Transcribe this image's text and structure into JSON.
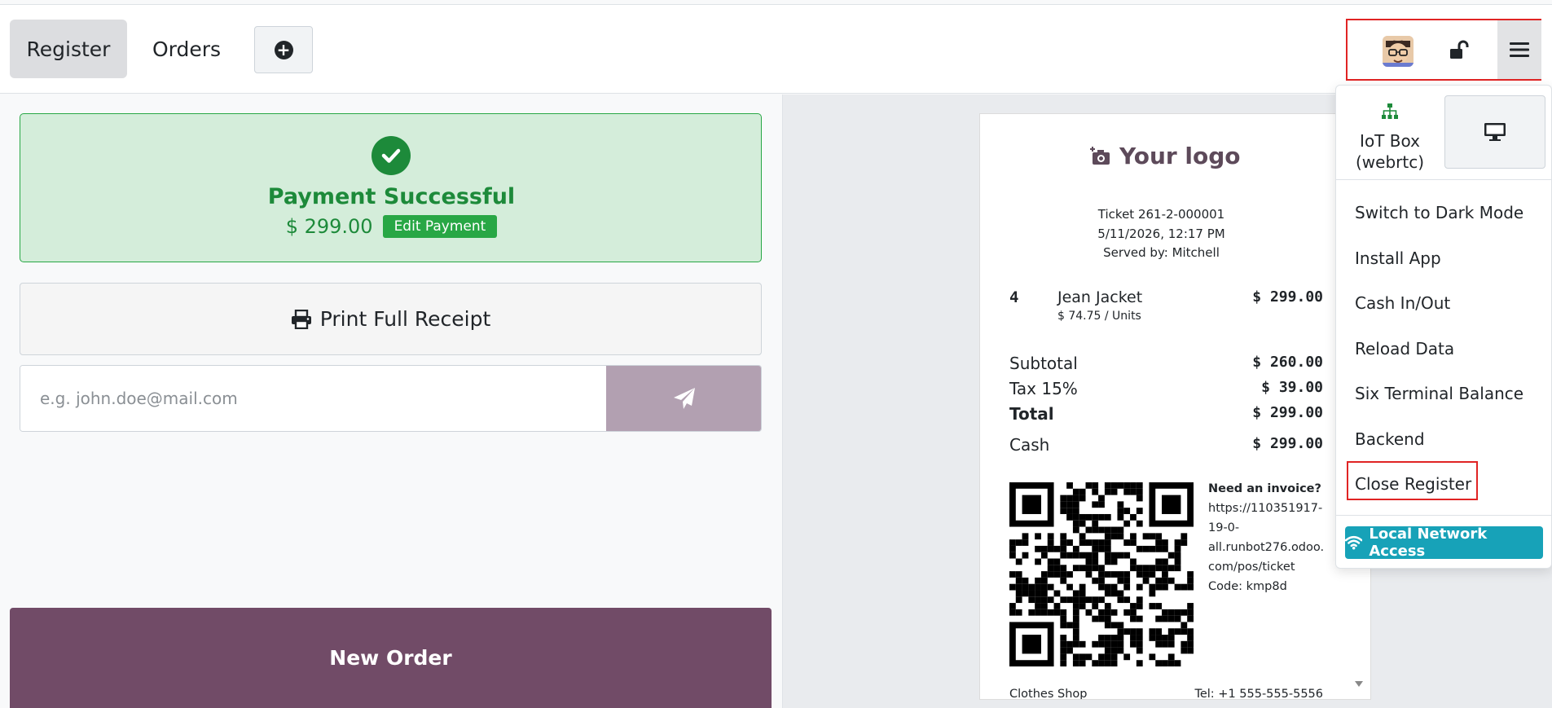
{
  "header": {
    "tabs": [
      {
        "label": "Register"
      },
      {
        "label": "Orders"
      }
    ]
  },
  "payment": {
    "title": "Payment Successful",
    "amount": "$ 299.00",
    "edit_label": "Edit Payment"
  },
  "actions": {
    "print_label": "Print Full Receipt",
    "email_placeholder": "e.g. john.doe@mail.com",
    "new_order_label": "New Order"
  },
  "receipt": {
    "logo_text": "Your logo",
    "ticket": "Ticket 261-2-000001",
    "datetime": "5/11/2026, 12:17 PM",
    "served_by": "Served by: Mitchell",
    "line": {
      "qty": "4",
      "product": "Jean Jacket",
      "unit_price": "$ 74.75 / Units",
      "total": "$ 299.00"
    },
    "subtotal_label": "Subtotal",
    "subtotal": "$ 260.00",
    "tax_label": "Tax 15%",
    "tax": "$ 39.00",
    "total_label": "Total",
    "total": "$ 299.00",
    "cash_label": "Cash",
    "cash": "$ 299.00",
    "invoice_title": "Need an invoice?",
    "invoice_url_lines": [
      "https://110351917-",
      "19-0-",
      "all.runbot276.odoo.",
      "com/pos/ticket"
    ],
    "invoice_code": "Code: kmp8d",
    "shop_name": "Clothes Shop",
    "phone": "Tel: +1 555-555-5556"
  },
  "menu": {
    "iot_label_1": "IoT Box",
    "iot_label_2": "(webrtc)",
    "items": [
      {
        "label": "Switch to Dark Mode"
      },
      {
        "label": "Install App"
      },
      {
        "label": "Cash In/Out"
      },
      {
        "label": "Reload Data"
      },
      {
        "label": "Six Terminal Balance"
      },
      {
        "label": "Backend"
      },
      {
        "label": "Close Register"
      }
    ],
    "network_label": "Local Network Access"
  },
  "colors": {
    "brand": "#714b67",
    "success": "#28a745",
    "info": "#17a2b8",
    "highlight": "#e02424"
  }
}
